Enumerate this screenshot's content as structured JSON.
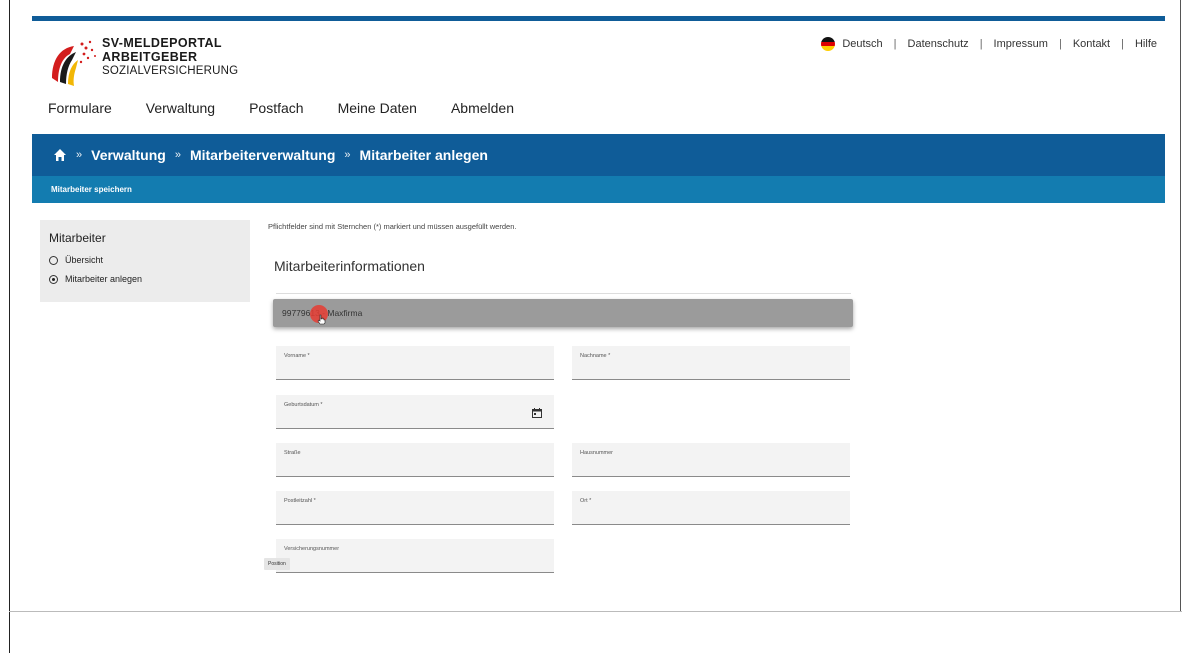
{
  "logo": {
    "line1": "SV-MELDEPORTAL",
    "line2": "ARBEITGEBER",
    "line3": "SOZIALVERSICHERUNG"
  },
  "util_nav": {
    "language": "Deutsch",
    "links": [
      "Datenschutz",
      "Impressum",
      "Kontakt",
      "Hilfe"
    ],
    "separator": "|"
  },
  "main_nav": [
    "Formulare",
    "Verwaltung",
    "Postfach",
    "Meine Daten",
    "Abmelden"
  ],
  "breadcrumb": {
    "separator": "»",
    "items": [
      "Verwaltung",
      "Mitarbeiterverwaltung",
      "Mitarbeiter anlegen"
    ]
  },
  "subbar": {
    "save_label": "Mitarbeiter speichern"
  },
  "sidebar": {
    "title": "Mitarbeiter",
    "items": [
      {
        "label": "Übersicht",
        "selected": false
      },
      {
        "label": "Mitarbeiter anlegen",
        "selected": true
      }
    ]
  },
  "form": {
    "hint": "Pflichtfelder sind mit Sternchen (*) markiert und müssen ausgefüllt werden.",
    "section_title": "Mitarbeiterinformationen",
    "employer_select": "99779613 - Maxfirma",
    "fields": {
      "vorname": "Vorname *",
      "nachname": "Nachname *",
      "geburtsdatum": "Geburtsdatum *",
      "strasse": "Straße",
      "hausnummer": "Hausnummer",
      "postleitzahl": "Postleitzahl *",
      "ort": "Ort *",
      "versicherungsnummer": "Versicherungsnummer"
    },
    "tooltip": "Position"
  },
  "colors": {
    "primary": "#0f5c98",
    "secondary": "#137cb0",
    "sidebar_bg": "#ececec",
    "select_bg": "#9b9b9b"
  }
}
